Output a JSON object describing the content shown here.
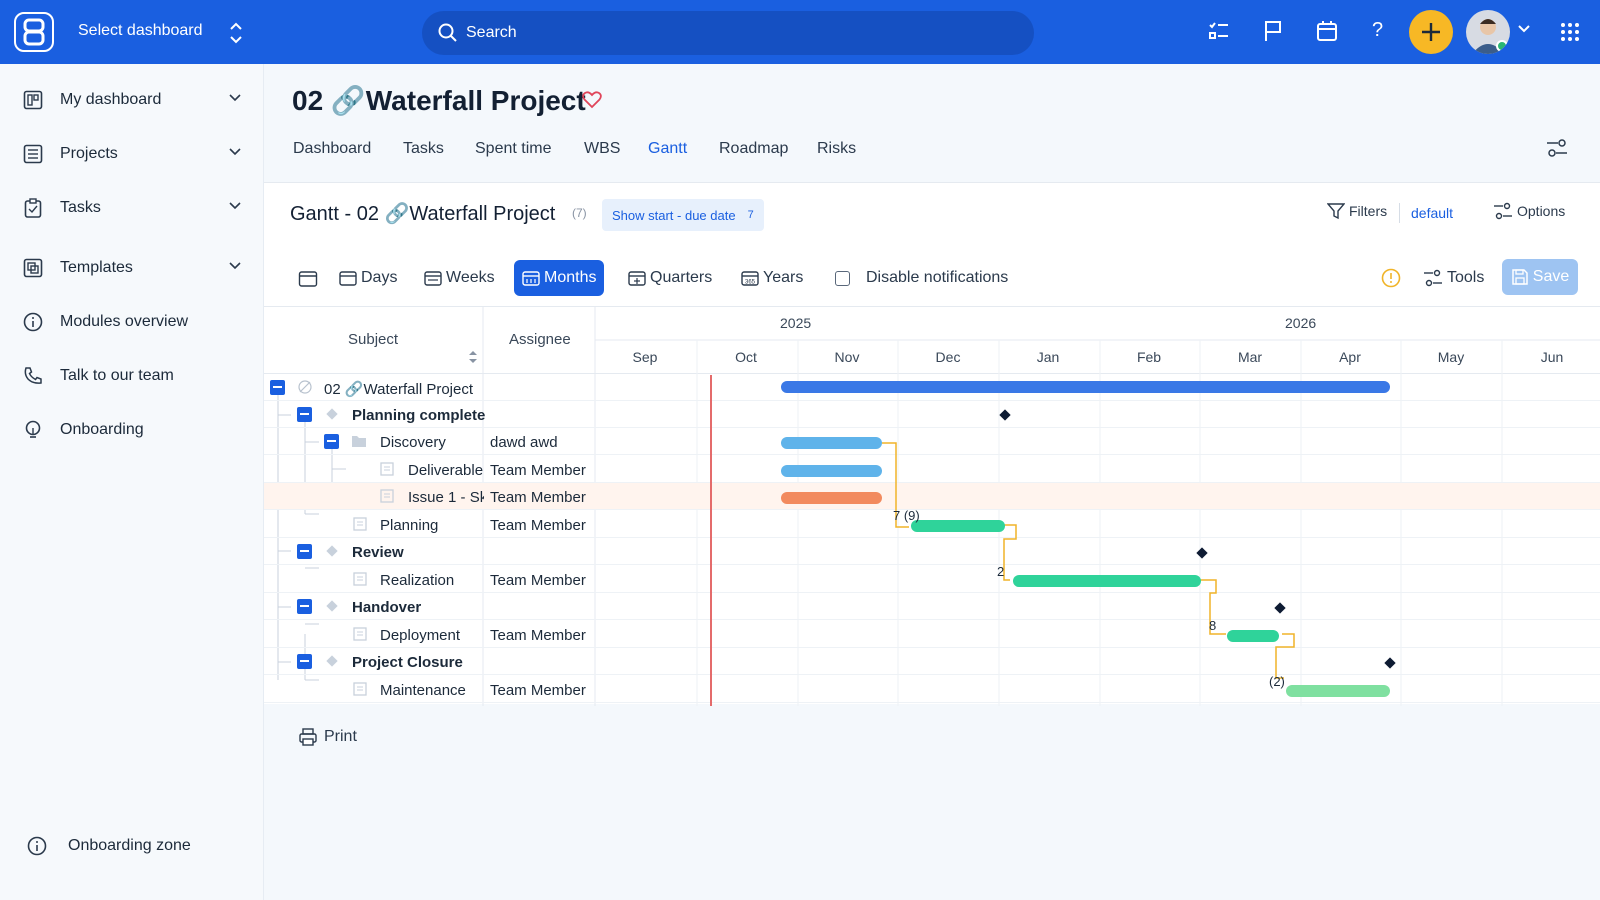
{
  "topbar": {
    "dashboard_label": "Select dashboard",
    "search_placeholder": "Search",
    "colors": {
      "bar": "#1a5fe0",
      "plus": "#f7b825"
    }
  },
  "sidebar": {
    "items": [
      {
        "label": "My dashboard",
        "icon": "dashboard-icon",
        "expandable": true
      },
      {
        "label": "Projects",
        "icon": "projects-icon",
        "expandable": true
      },
      {
        "label": "Tasks",
        "icon": "tasks-icon",
        "expandable": true
      },
      {
        "label": "Templates",
        "icon": "templates-icon",
        "expandable": true
      },
      {
        "label": "Modules overview",
        "icon": "info-icon",
        "expandable": false
      },
      {
        "label": "Talk to our team",
        "icon": "phone-icon",
        "expandable": false
      },
      {
        "label": "Onboarding",
        "icon": "bulb-icon",
        "expandable": false
      }
    ],
    "footer_label": "Onboarding zone"
  },
  "project": {
    "title": "02 🔗Waterfall Project",
    "tabs": [
      "Dashboard",
      "Tasks",
      "Spent time",
      "WBS",
      "Gantt",
      "Roadmap",
      "Risks"
    ],
    "active_tab": "Gantt"
  },
  "gantt": {
    "title": "Gantt - 02 🔗Waterfall Project",
    "count": "(7)",
    "show_dates_label": "Show start - due date",
    "show_dates_count": "7",
    "filters_label": "Filters",
    "filter_preset": "default",
    "options_label": "Options",
    "zoom": [
      "Days",
      "Weeks",
      "Months",
      "Quarters",
      "Years"
    ],
    "active_zoom": "Months",
    "disable_notifications": "Disable notifications",
    "tools_label": "Tools",
    "save_label": "Save",
    "columns": {
      "subject": "Subject",
      "assignee": "Assignee"
    },
    "years": [
      "2025",
      "2026"
    ],
    "months": [
      "Sep",
      "Oct",
      "Nov",
      "Dec",
      "Jan",
      "Feb",
      "Mar",
      "Apr",
      "May",
      "Jun"
    ],
    "rows": [
      {
        "subject": "02 🔗Waterfall Project",
        "assignee": "",
        "bold": false
      },
      {
        "subject": "Planning completed",
        "assignee": "",
        "bold": true
      },
      {
        "subject": "Discovery",
        "assignee": "dawd awd",
        "bold": false
      },
      {
        "subject": "Deliverable",
        "assignee": "Team Member",
        "bold": false
      },
      {
        "subject": "Issue 1 - Sk",
        "assignee": "Team Member",
        "bold": false
      },
      {
        "subject": "Planning",
        "assignee": "Team Member",
        "bold": false
      },
      {
        "subject": "Review",
        "assignee": "",
        "bold": true
      },
      {
        "subject": "Realization",
        "assignee": "Team Member",
        "bold": false
      },
      {
        "subject": "Handover",
        "assignee": "",
        "bold": true
      },
      {
        "subject": "Deployment",
        "assignee": "Team Member",
        "bold": false
      },
      {
        "subject": "Project Closure",
        "assignee": "",
        "bold": true
      },
      {
        "subject": "Maintenance",
        "assignee": "Team Member",
        "bold": false
      }
    ],
    "lag_labels": [
      "7 (9)",
      "2",
      "8",
      "(2)"
    ],
    "print_label": "Print"
  }
}
